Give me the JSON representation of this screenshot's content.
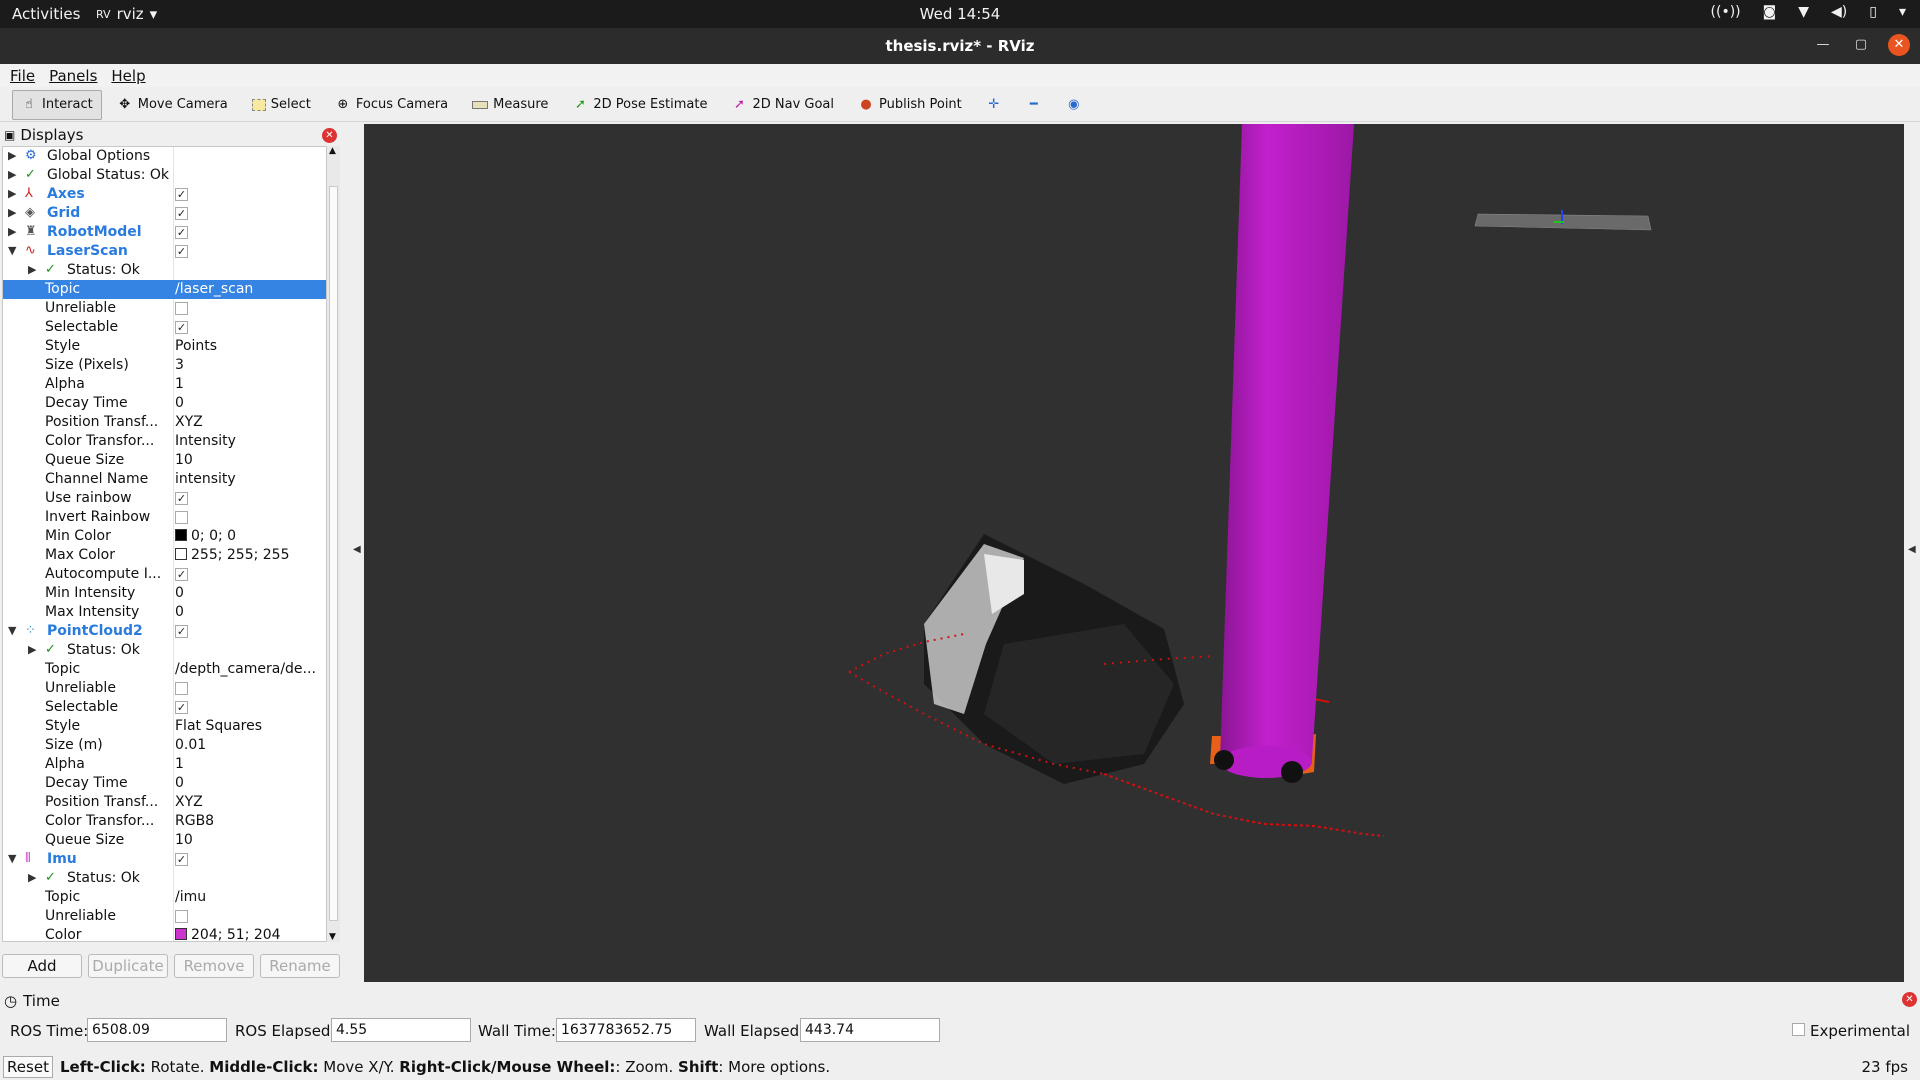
{
  "system": {
    "activities": "Activities",
    "app_name": "rviz",
    "clock": "Wed 14:54"
  },
  "window": {
    "title": "thesis.rviz* - RViz"
  },
  "menu": {
    "file": "File",
    "panels": "Panels",
    "help": "Help"
  },
  "toolbar": {
    "interact": "Interact",
    "move_camera": "Move Camera",
    "select": "Select",
    "focus_camera": "Focus Camera",
    "measure": "Measure",
    "pose_estimate": "2D Pose Estimate",
    "nav_goal": "2D Nav Goal",
    "publish_point": "Publish Point"
  },
  "displays": {
    "title": "Displays",
    "global_options": "Global Options",
    "global_status": "Global Status: Ok",
    "axes": "Axes",
    "grid": "Grid",
    "robot_model": "RobotModel",
    "laser_scan": {
      "name": "LaserScan",
      "status": "Status: Ok",
      "props": [
        {
          "k": "Topic",
          "v": "/laser_scan"
        },
        {
          "k": "Unreliable",
          "v": ""
        },
        {
          "k": "Selectable",
          "v": ""
        },
        {
          "k": "Style",
          "v": "Points"
        },
        {
          "k": "Size (Pixels)",
          "v": "3"
        },
        {
          "k": "Alpha",
          "v": "1"
        },
        {
          "k": "Decay Time",
          "v": "0"
        },
        {
          "k": "Position Transf...",
          "v": "XYZ"
        },
        {
          "k": "Color Transfor...",
          "v": "Intensity"
        },
        {
          "k": "Queue Size",
          "v": "10"
        },
        {
          "k": "Channel Name",
          "v": "intensity"
        },
        {
          "k": "Use rainbow",
          "v": ""
        },
        {
          "k": "Invert Rainbow",
          "v": ""
        },
        {
          "k": "Min Color",
          "v": "0; 0; 0"
        },
        {
          "k": "Max Color",
          "v": "255; 255; 255"
        },
        {
          "k": "Autocompute I...",
          "v": ""
        },
        {
          "k": "Min Intensity",
          "v": "0"
        },
        {
          "k": "Max Intensity",
          "v": "0"
        }
      ]
    },
    "point_cloud": {
      "name": "PointCloud2",
      "status": "Status: Ok",
      "props": [
        {
          "k": "Topic",
          "v": "/depth_camera/de..."
        },
        {
          "k": "Unreliable",
          "v": ""
        },
        {
          "k": "Selectable",
          "v": ""
        },
        {
          "k": "Style",
          "v": "Flat Squares"
        },
        {
          "k": "Size (m)",
          "v": "0.01"
        },
        {
          "k": "Alpha",
          "v": "1"
        },
        {
          "k": "Decay Time",
          "v": "0"
        },
        {
          "k": "Position Transf...",
          "v": "XYZ"
        },
        {
          "k": "Color Transfor...",
          "v": "RGB8"
        },
        {
          "k": "Queue Size",
          "v": "10"
        }
      ]
    },
    "imu": {
      "name": "Imu",
      "status": "Status: Ok",
      "props": [
        {
          "k": "Topic",
          "v": "/imu"
        },
        {
          "k": "Unreliable",
          "v": ""
        },
        {
          "k": "Color",
          "v": "204; 51; 204"
        }
      ]
    },
    "buttons": {
      "add": "Add",
      "duplicate": "Duplicate",
      "remove": "Remove",
      "rename": "Rename"
    }
  },
  "colors": {
    "selection": "#3584e4",
    "cylinder": "#b81cc4",
    "laser": "#d01010",
    "viewport": "#303030"
  },
  "time": {
    "title": "Time",
    "ros_time_label": "ROS Time:",
    "ros_time": "6508.09",
    "ros_elapsed_label": "ROS Elapsed:",
    "ros_elapsed": "4.55",
    "wall_time_label": "Wall Time:",
    "wall_time": "1637783652.75",
    "wall_elapsed_label": "Wall Elapsed:",
    "wall_elapsed": "443.74",
    "experimental": "Experimental"
  },
  "status": {
    "reset": "Reset",
    "left_click": "Left-Click:",
    "left_click_txt": "Rotate.",
    "middle_click": "Middle-Click:",
    "middle_click_txt": "Move X/Y.",
    "right_click": "Right-Click/Mouse Wheel:",
    "right_click_txt": ": Zoom.",
    "shift": "Shift",
    "shift_txt": ": More options.",
    "fps": "23 fps"
  }
}
